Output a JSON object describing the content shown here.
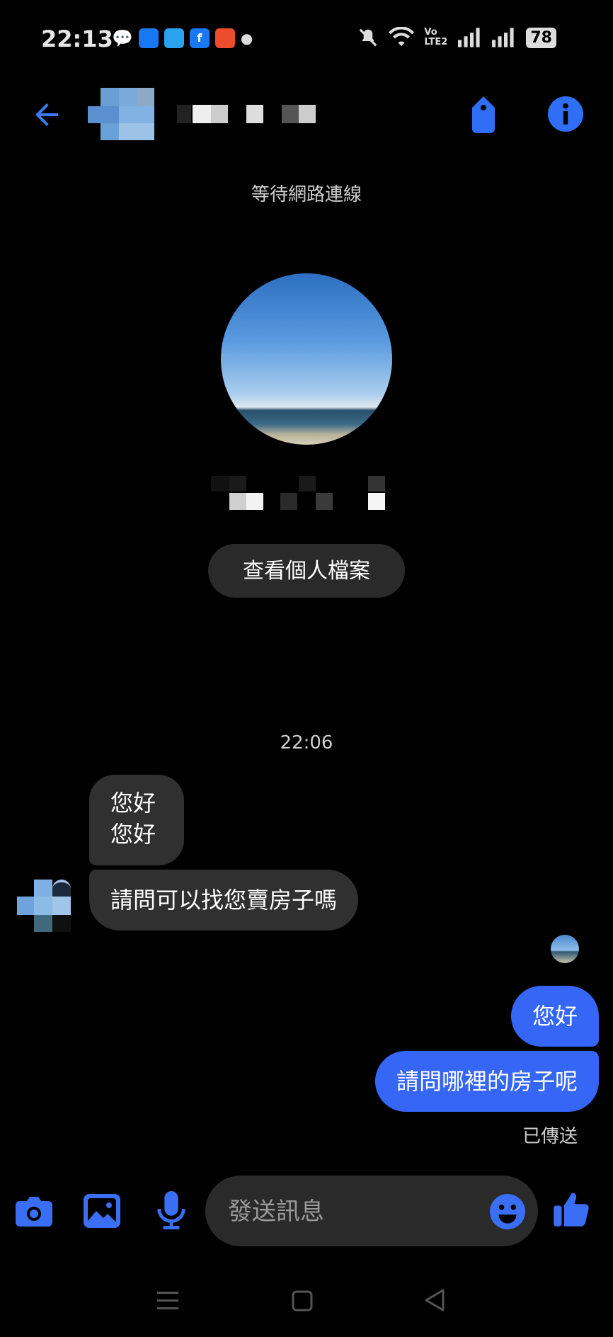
{
  "status_bar": {
    "time": "22:13",
    "network_label": "Vo LTE2",
    "battery": "78"
  },
  "header": {
    "connection_status": "等待網路連線"
  },
  "profile": {
    "view_profile_label": "查看個人檔案"
  },
  "conversation": {
    "timestamp": "22:06",
    "incoming": [
      "您好\n您好",
      "請問可以找您賣房子嗎"
    ],
    "outgoing": [
      "您好",
      "請問哪裡的房子呢"
    ],
    "sent_status": "已傳送"
  },
  "composer": {
    "placeholder": "發送訊息"
  },
  "colors": {
    "accent": "#3566f5",
    "incoming_bubble": "#303030",
    "background": "#000000"
  },
  "icons": [
    "back-arrow-icon",
    "tag-icon",
    "info-icon",
    "camera-icon",
    "gallery-icon",
    "microphone-icon",
    "emoji-icon",
    "thumbs-up-icon",
    "nav-menu-icon",
    "nav-home-icon",
    "nav-back-icon"
  ]
}
